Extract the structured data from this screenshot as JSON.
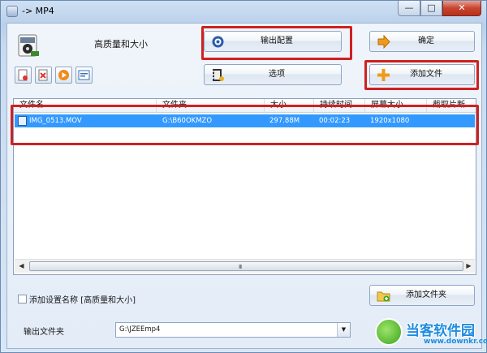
{
  "window": {
    "title": "-> MP4",
    "minimize": "—",
    "maximize": "□",
    "close": "✕"
  },
  "format": {
    "icon": "mp4-format-icon",
    "label": "高质量和大小"
  },
  "buttons": {
    "output_config": "输出配置",
    "ok": "确定",
    "options": "选项",
    "add_file": "添加文件",
    "add_folder": "添加文件夹"
  },
  "toolbar_icons": [
    "delete-icon",
    "remove-icon",
    "play-icon",
    "info-icon"
  ],
  "list": {
    "columns": [
      "文件名",
      "文件夹",
      "大小",
      "持续时间",
      "屏幕大小",
      "截取片断"
    ],
    "rows": [
      {
        "name": "IMG_0513.MOV",
        "folder": "G:\\B60OKMZO",
        "size": "297.88M",
        "duration": "00:02:23",
        "screen": "1920x1080",
        "clip": ""
      }
    ],
    "scroll_grip": "III"
  },
  "bottom": {
    "checkbox_label": "添加设置名称 [高质量和大小]",
    "output_folder_label": "输出文件夹",
    "output_folder_value": "G:\\JZEEmp4"
  },
  "watermark": {
    "text": "当客软件园",
    "url": "www.downkr.com"
  },
  "colors": {
    "highlight": "#d02020",
    "selection": "#3399ff"
  }
}
